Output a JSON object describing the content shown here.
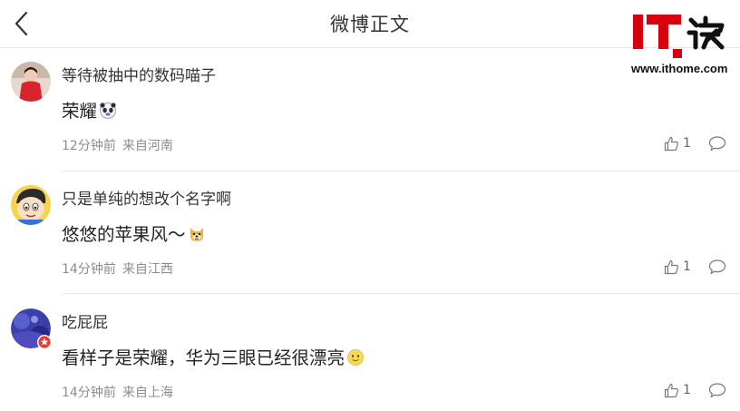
{
  "header": {
    "back_icon": "chevron-left-icon",
    "title": "微博正文"
  },
  "watermark": {
    "logo_text": "IT之家",
    "url": "www.ithome.com",
    "accent": "#d7000f"
  },
  "comments": [
    {
      "username": "等待被抽中的数码喵子",
      "text": "荣耀",
      "emoji": "panda-face-emoji",
      "time": "12分钟前",
      "source": "来自河南",
      "likes": "1",
      "avatar": "avatar-red-outfit"
    },
    {
      "username": "只是单纯的想改个名字啊",
      "text": "悠悠的苹果风～",
      "emoji": "doge-emoji",
      "time": "14分钟前",
      "source": "来自江西",
      "likes": "1",
      "avatar": "avatar-cartoon-boy"
    },
    {
      "username": "吃屁屁",
      "text": "看样子是荣耀，华为三眼已经很漂亮",
      "emoji": "smiley-emoji",
      "time": "14分钟前",
      "source": "来自上海",
      "likes": "1",
      "avatar": "avatar-blue-pattern"
    }
  ],
  "colors": {
    "text": "#333333",
    "meta": "#8c8c8c",
    "divider": "#e9e9e9"
  }
}
